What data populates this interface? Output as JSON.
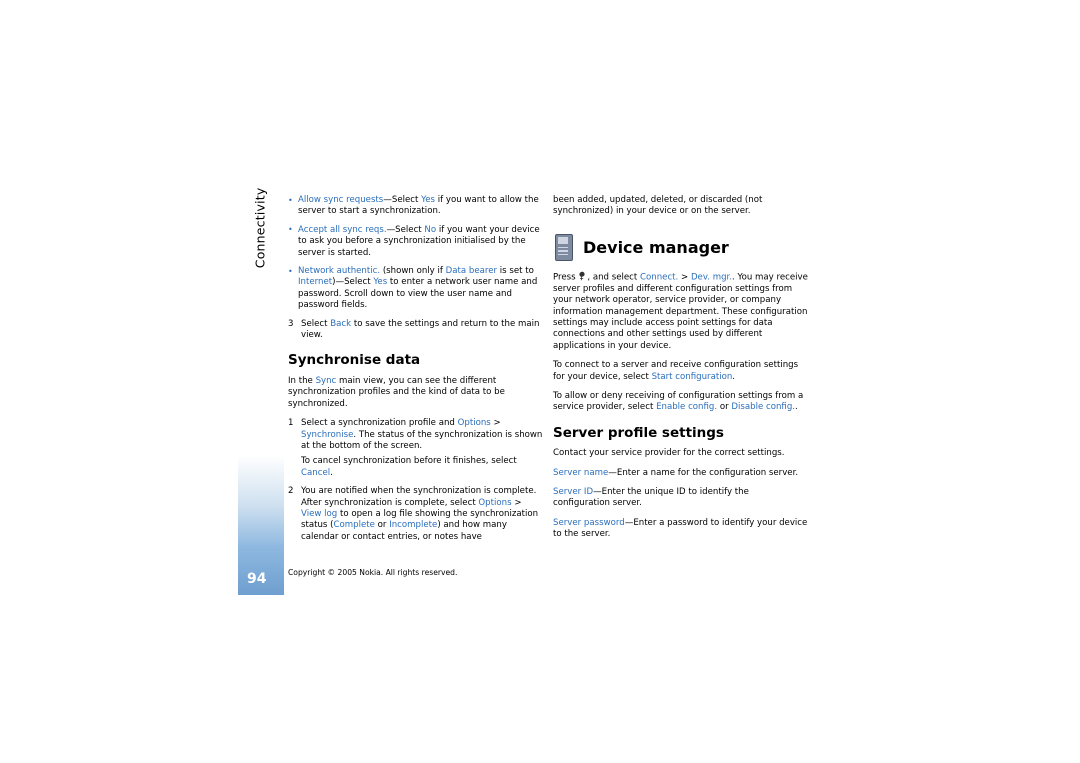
{
  "page": {
    "chapter_tab": "Connectivity",
    "page_number": "94",
    "footer": "Copyright © 2005 Nokia. All rights reserved."
  },
  "left_column": {
    "bullets": [
      {
        "term": "Allow sync requests",
        "text_1": "—Select ",
        "link_1": "Yes",
        "text_2": " if you want to allow the server to start a synchronization."
      },
      {
        "term": "Accept all sync reqs.",
        "text_1": "—Select ",
        "link_1": "No",
        "text_2": " if you want your device to ask you before a synchronization initialised by the server is started."
      },
      {
        "term": "Network authentic.",
        "text_1": " (shown only if ",
        "link_1": "Data bearer",
        "text_2": " is set to ",
        "link_2": "Internet",
        "text_3": ")—Select ",
        "link_3": "Yes",
        "text_4": " to enter a network user name and password. Scroll down to view the user name and password fields."
      }
    ],
    "step3": {
      "num": "3",
      "text_1": "Select ",
      "link_1": "Back",
      "text_2": " to save the settings and return to the main view."
    },
    "heading": "Synchronise data",
    "intro": {
      "text_1": "In the ",
      "link_1": "Sync",
      "text_2": " main view, you can see the different synchronization profiles and the kind of data to be synchronized."
    },
    "steps": [
      {
        "num": "1",
        "text_1": "Select a synchronization profile and ",
        "link_1": "Options",
        "text_2": " > ",
        "link_2": "Synchronise",
        "text_3": ". The status of the synchronization is shown at the bottom of the screen.",
        "sub_text_1": "To cancel synchronization before it finishes, select ",
        "sub_link_1": "Cancel",
        "sub_text_2": "."
      },
      {
        "num": "2",
        "text_1": "You are notified when the synchronization is complete. After synchronization is complete, select ",
        "link_1": "Options",
        "text_2": " > ",
        "link_2": "View log",
        "text_3": " to open a log file showing the synchronization status (",
        "link_3": "Complete",
        "text_4": " or ",
        "link_4": "Incomplete",
        "text_5": ") and how many calendar or contact entries, or notes have"
      }
    ]
  },
  "right_column": {
    "continued": "been added, updated, deleted, or discarded (not synchronized) in your device or on the server.",
    "title": "Device manager",
    "press_para": {
      "text_1": "Press ",
      "icon": "menu-key-icon",
      "text_2": ", and select ",
      "link_1": "Connect.",
      "text_3": " > ",
      "link_2": "Dev. mgr.",
      "text_4": ". You may receive server profiles and different configuration settings from your network operator, service provider, or company information management department. These configuration settings may include access point settings for data connections and other settings used by different applications in your device."
    },
    "connect_para": {
      "text_1": "To connect to a server and receive configuration settings for your device, select ",
      "link_1": "Start configuration",
      "text_2": "."
    },
    "allow_para": {
      "text_1": "To allow or deny receiving of configuration settings from a service provider, select ",
      "link_1": "Enable config.",
      "text_2": " or ",
      "link_2": "Disable config.",
      "text_3": "."
    },
    "heading": "Server profile settings",
    "contact_para": "Contact your service provider for the correct settings.",
    "settings": [
      {
        "term": "Server name",
        "text": "—Enter a name for the configuration server."
      },
      {
        "term": "Server ID",
        "text": "—Enter the unique ID to identify the configuration server."
      },
      {
        "term": "Server password",
        "text": "—Enter a password to identify your device to the server."
      }
    ]
  }
}
